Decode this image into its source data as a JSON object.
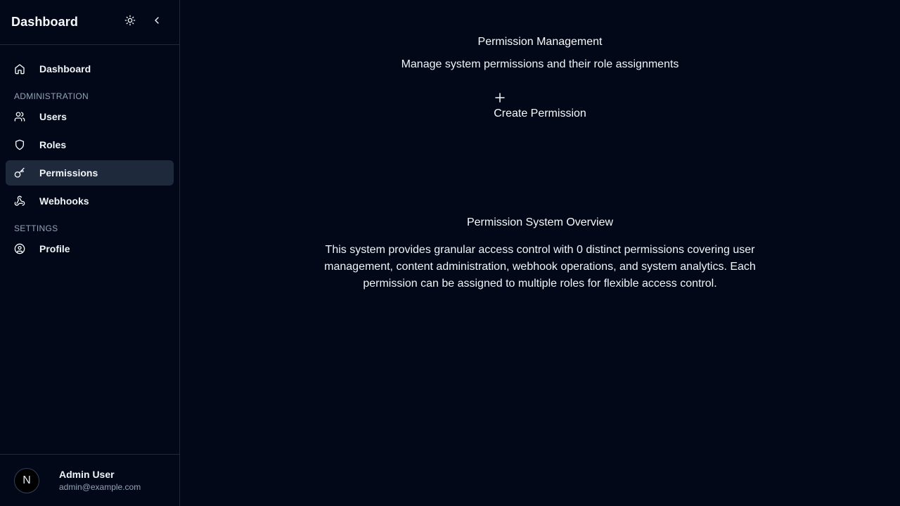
{
  "sidebar": {
    "brand": "Dashboard",
    "theme_toggle_icon": "sun-icon",
    "collapse_icon": "chevron-left-icon",
    "nav": {
      "dashboard": {
        "label": "Dashboard",
        "icon": "home-icon"
      },
      "section_admin": "ADMINISTRATION",
      "users": {
        "label": "Users",
        "icon": "users-icon"
      },
      "roles": {
        "label": "Roles",
        "icon": "shield-icon"
      },
      "permissions": {
        "label": "Permissions",
        "icon": "key-icon",
        "active": true
      },
      "webhooks": {
        "label": "Webhooks",
        "icon": "webhook-icon"
      },
      "section_settings": "SETTINGS",
      "profile": {
        "label": "Profile",
        "icon": "user-circle-icon"
      }
    },
    "user": {
      "avatar_letter": "N",
      "name": "Admin User",
      "email": "admin@example.com"
    }
  },
  "main": {
    "title": "Permission Management",
    "subtitle": "Manage system permissions and their role assignments",
    "create_button": {
      "label": "Create Permission",
      "icon": "plus-icon"
    },
    "overview": {
      "title": "Permission System Overview",
      "text": "This system provides granular access control with 0 distinct permissions covering user management, content administration, webhook operations, and system analytics. Each permission can be assigned to multiple roles for flexible access control."
    }
  },
  "colors": {
    "background": "#020817",
    "border": "#1e293b",
    "active_item": "#1e293b",
    "text": "#f8fafc",
    "muted_text": "#94a3b8"
  }
}
